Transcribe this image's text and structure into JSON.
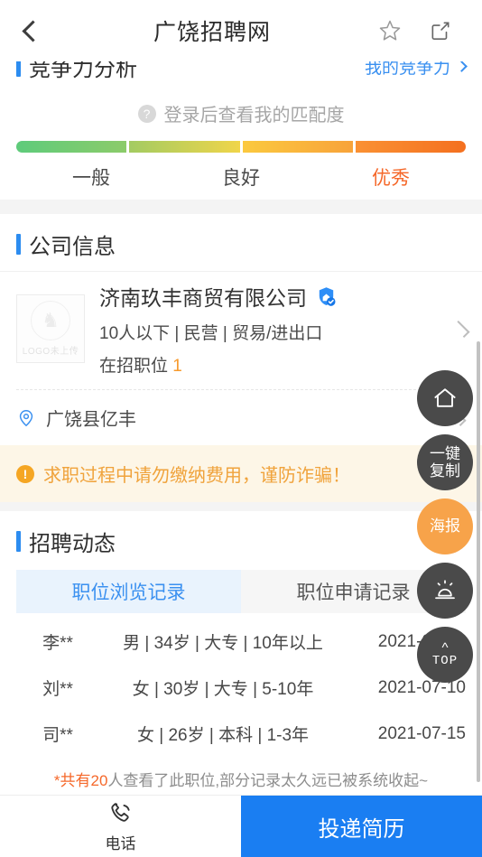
{
  "header": {
    "title": "广饶招聘网",
    "back_icon": "chevron-left-icon",
    "favorite_icon": "star-outline-icon",
    "share_icon": "share-box-icon"
  },
  "competitiveness": {
    "title": "竞争力分析",
    "link_label": "我的竞争力",
    "match_hint": "登录后查看我的匹配度",
    "help_icon": "question-circle-icon",
    "levels": [
      "一般",
      "良好",
      "优秀"
    ],
    "highlight_color": "#f5682a",
    "segment_colors": [
      "#5ecb7b",
      "#a3cb62",
      "#fbc93f",
      "#f4701f"
    ]
  },
  "company": {
    "section_title": "公司信息",
    "logo_placeholder": "LOGO未上传",
    "name": "济南玖丰商贸有限公司",
    "verified_icon": "verified-shield-icon",
    "meta": "10人以下 | 民营 | 贸易/进出口",
    "jobs_label": "在招职位",
    "jobs_count": "1",
    "jobs_count_color": "#f79a2c",
    "address": "广饶县亿丰",
    "address_icon": "location-pin-icon",
    "chevron_icon": "chevron-right-icon"
  },
  "warning": {
    "icon": "alert-circle-icon",
    "text": "求职过程中请勿缴纳费用，谨防诈骗！",
    "color": "#f0a33c",
    "background": "#fdf6e7"
  },
  "dynamics": {
    "section_title": "招聘动态",
    "tabs": [
      {
        "label": "职位浏览记录",
        "active": true
      },
      {
        "label": "职位申请记录",
        "active": false
      }
    ],
    "records": [
      {
        "name": "李**",
        "info": "男 | 34岁 | 大专 | 10年以上",
        "date": "2021-07-16"
      },
      {
        "name": "刘**",
        "info": "女 | 30岁 | 大专 | 5-10年",
        "date": "2021-07-10"
      },
      {
        "name": "司**",
        "info": "女 | 26岁 | 本科 | 1-3年",
        "date": "2021-07-15"
      }
    ],
    "footnote_prefix": "*共有",
    "footnote_count": "20",
    "footnote_suffix": "人查看了此职位,部分记录太久远已被系统收起~"
  },
  "fabs": [
    {
      "name": "home",
      "label": "",
      "icon": "home-icon",
      "style": "dark"
    },
    {
      "name": "one-click-copy",
      "label_line1": "一键",
      "label_line2": "复制",
      "icon": "",
      "style": "dark"
    },
    {
      "name": "poster",
      "label": "海报",
      "icon": "",
      "style": "orange"
    },
    {
      "name": "alarm",
      "label": "",
      "icon": "alarm-light-icon",
      "style": "dark"
    },
    {
      "name": "back-to-top",
      "label": "TOP",
      "icon": "chevron-up-icon",
      "style": "dark"
    }
  ],
  "bottom": {
    "phone_icon": "phone-call-icon",
    "phone_label": "电话",
    "apply_label": "投递简历",
    "apply_color": "#1a7ef2"
  }
}
